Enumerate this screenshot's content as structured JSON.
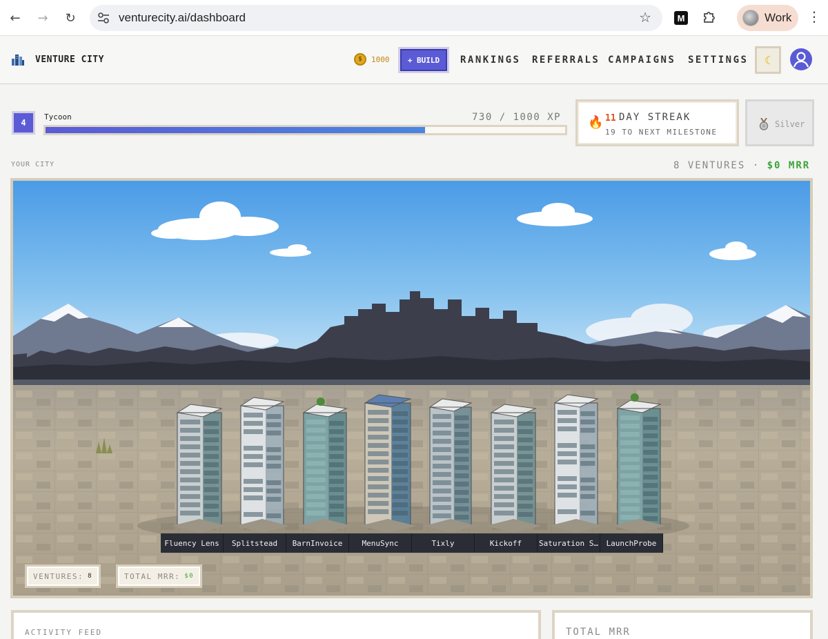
{
  "browser": {
    "url": "venturecity.ai/dashboard",
    "profile_label": "Work"
  },
  "header": {
    "brand": "VENTURE CITY",
    "coins": "1000",
    "build_label": "+ BUILD",
    "nav": [
      "RANKINGS",
      "REFERRALS",
      "CAMPAIGNS",
      "SETTINGS"
    ]
  },
  "progress": {
    "level": "4",
    "rank": "Tycoon",
    "xp_text": "730 / 1000 XP",
    "xp_current": 730,
    "xp_max": 1000
  },
  "streak": {
    "count": "11",
    "label": "DAY STREAK",
    "sub": "19 TO NEXT MILESTONE"
  },
  "tier": {
    "label": "Silver"
  },
  "city": {
    "title": "YOUR CITY",
    "ventures_meta": "8 VENTURES",
    "separator": "·",
    "mrr_meta": "$0 MRR",
    "buildings": [
      "Fluency Lens",
      "Splitstead",
      "BarnInvoice",
      "MenuSync",
      "Tixly",
      "Kickoff",
      "Saturation S…",
      "LaunchProbe"
    ],
    "stats": {
      "ventures_label": "VENTURES:",
      "ventures_value": "8",
      "mrr_label": "TOTAL MRR:",
      "mrr_value": "$0"
    }
  },
  "panels": {
    "activity_title": "ACTIVITY FEED",
    "mrr_title": "TOTAL MRR"
  },
  "colors": {
    "accent": "#5b5bd6",
    "mrr_green": "#3aa53a",
    "streak_orange": "#e0521e",
    "coin_gold": "#e1a721"
  }
}
